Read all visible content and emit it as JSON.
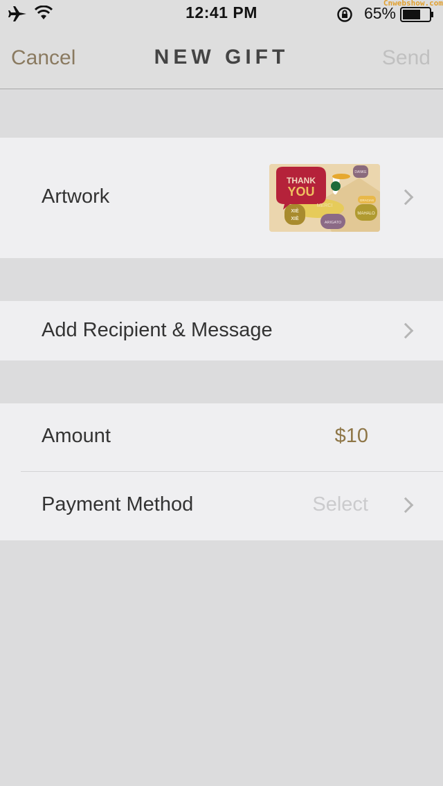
{
  "status_bar": {
    "time": "12:41 PM",
    "battery_percent": "65%",
    "watermark": "Cnwebshow.com",
    "icons": [
      "airplane-icon",
      "wifi-icon",
      "rotation-lock-icon",
      "battery-icon"
    ]
  },
  "nav": {
    "cancel_label": "Cancel",
    "title": "NEW GIFT",
    "send_label": "Send"
  },
  "artwork": {
    "label": "Artwork",
    "card_text": {
      "thank": "THANK",
      "you": "YOU",
      "xie": "XIÈ",
      "xie2": "XIÈ",
      "merci": "MERCI",
      "arigato": "ARIGATO",
      "danke": "DANKE",
      "gracias": "GRACIAS",
      "mahalo": "MAHALO"
    }
  },
  "recipient": {
    "label": "Add Recipient & Message"
  },
  "amount": {
    "label": "Amount",
    "value": "$10"
  },
  "payment": {
    "label": "Payment Method",
    "value": "Select"
  },
  "colors": {
    "accent": "#8a7a60",
    "amount": "#8e7647",
    "disabled": "#c0c0c0",
    "background": "#dcdcdd",
    "row": "#efeff1"
  }
}
